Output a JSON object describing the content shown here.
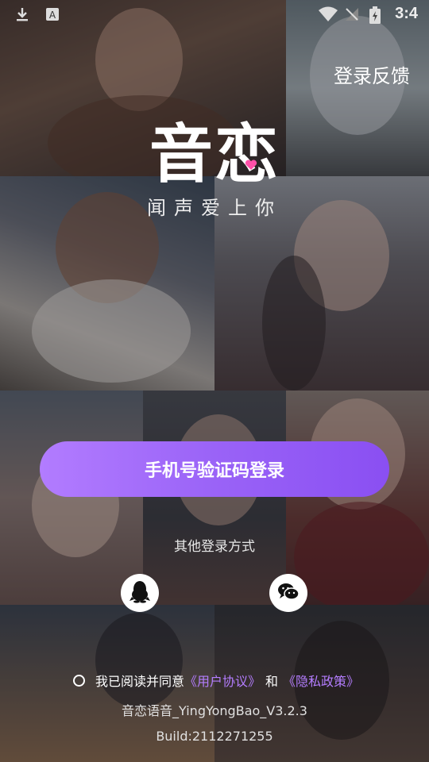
{
  "status_bar": {
    "time": "3:4"
  },
  "header": {
    "feedback": "登录反馈"
  },
  "logo": {
    "title": "音恋",
    "slogan": "闻声爱上你"
  },
  "login": {
    "primary_button": "手机号验证码登录",
    "other_methods_label": "其他登录方式",
    "qq_icon": "qq-penguin-icon",
    "wechat_icon": "wechat-icon"
  },
  "agreement": {
    "prefix": "我已阅读并同意",
    "user_agreement": "《用户协议》",
    "and": "和",
    "privacy_policy": "《隐私政策》"
  },
  "footer": {
    "version": "音恋语音_YingYongBao_V3.2.3",
    "build": "Build:2112271255"
  },
  "colors": {
    "accent": "#9a63f7",
    "link": "#b47dff",
    "heart": "#ff4fa8"
  }
}
